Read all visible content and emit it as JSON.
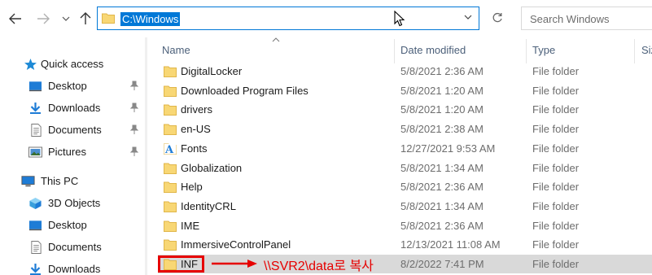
{
  "toolbar": {
    "address_path": "C:\\Windows",
    "search_placeholder": "Search Windows"
  },
  "sidebar": {
    "quick_access": "Quick access",
    "items": [
      {
        "label": "Desktop",
        "icon": "desktop-icon",
        "pinned": true
      },
      {
        "label": "Downloads",
        "icon": "download-icon",
        "pinned": true
      },
      {
        "label": "Documents",
        "icon": "document-icon",
        "pinned": true
      },
      {
        "label": "Pictures",
        "icon": "picture-icon",
        "pinned": true
      }
    ],
    "this_pc": "This PC",
    "pc_items": [
      {
        "label": "3D Objects",
        "icon": "cube-icon"
      },
      {
        "label": "Desktop",
        "icon": "desktop-icon"
      },
      {
        "label": "Documents",
        "icon": "document-icon"
      },
      {
        "label": "Downloads",
        "icon": "download-icon"
      }
    ]
  },
  "columns": {
    "name": "Name",
    "date": "Date modified",
    "type": "Type",
    "size": "Siz"
  },
  "rows": [
    {
      "name": "DigitalLocker",
      "date": "5/8/2021 2:36 AM",
      "type": "File folder",
      "icon": "folder-icon"
    },
    {
      "name": "Downloaded Program Files",
      "date": "5/8/2021 1:20 AM",
      "type": "File folder",
      "icon": "folder-icon"
    },
    {
      "name": "drivers",
      "date": "5/8/2021 1:20 AM",
      "type": "File folder",
      "icon": "folder-icon"
    },
    {
      "name": "en-US",
      "date": "5/8/2021 2:38 AM",
      "type": "File folder",
      "icon": "folder-icon"
    },
    {
      "name": "Fonts",
      "date": "12/27/2021 9:53 AM",
      "type": "File folder",
      "icon": "fonts-folder-icon"
    },
    {
      "name": "Globalization",
      "date": "5/8/2021 1:34 AM",
      "type": "File folder",
      "icon": "folder-icon"
    },
    {
      "name": "Help",
      "date": "5/8/2021 2:36 AM",
      "type": "File folder",
      "icon": "folder-icon"
    },
    {
      "name": "IdentityCRL",
      "date": "5/8/2021 1:34 AM",
      "type": "File folder",
      "icon": "folder-icon"
    },
    {
      "name": "IME",
      "date": "5/8/2021 2:36 AM",
      "type": "File folder",
      "icon": "folder-icon"
    },
    {
      "name": "ImmersiveControlPanel",
      "date": "12/13/2021 11:08 AM",
      "type": "File folder",
      "icon": "folder-icon"
    },
    {
      "name": "INF",
      "date": "8/2/2022 7:41 PM",
      "type": "File folder",
      "icon": "folder-icon",
      "selected": true
    }
  ],
  "annotation": {
    "text": "\\\\SVR2\\data로 복사",
    "color": "#e60000"
  },
  "colors": {
    "accent": "#0078d7",
    "folder": "#f8d775",
    "selection": "#d9d9d9"
  }
}
